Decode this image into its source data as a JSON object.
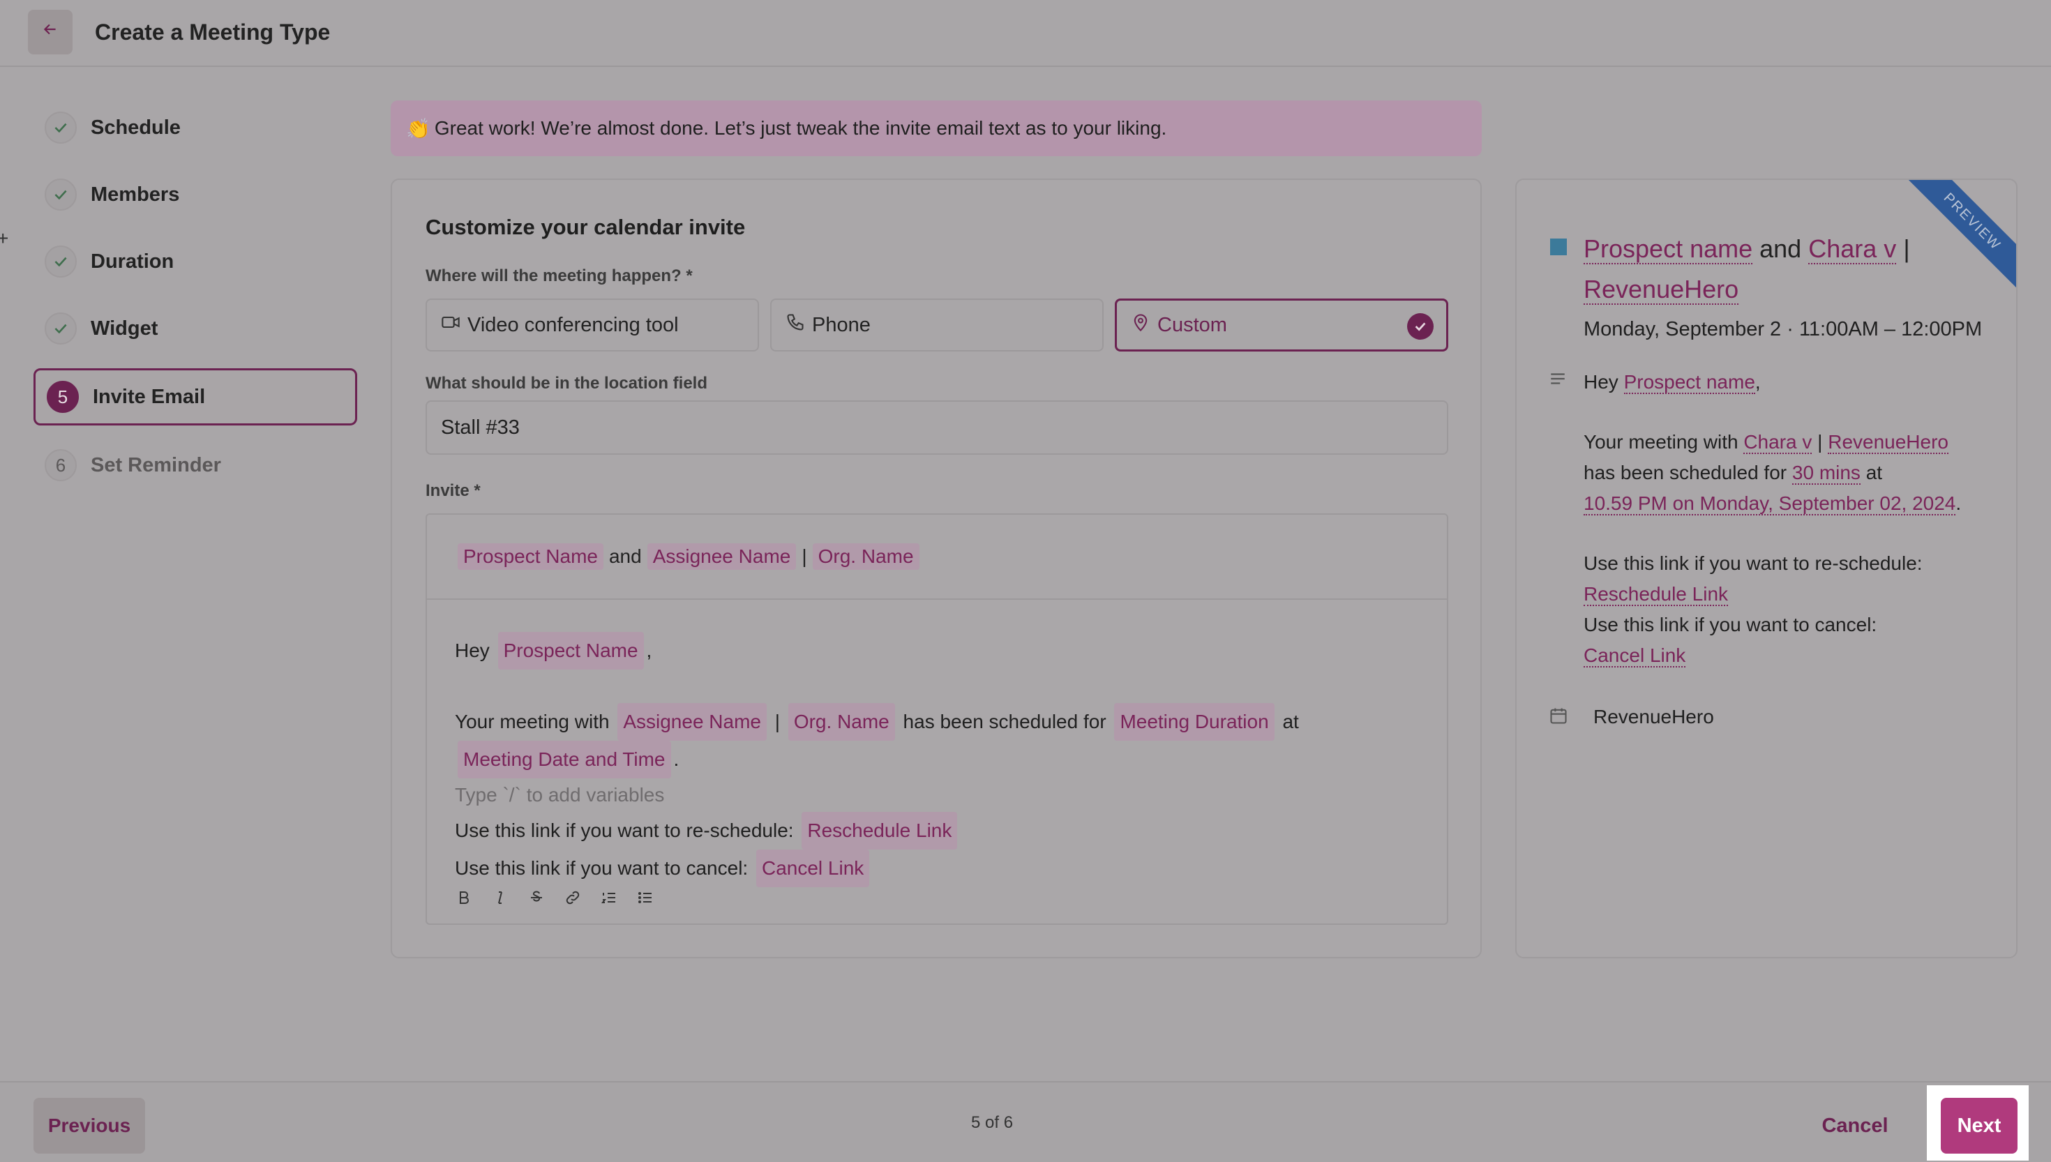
{
  "header": {
    "title": "Create a Meeting Type",
    "back_icon": "arrow-left-icon"
  },
  "stepper": {
    "steps": [
      {
        "label": "Schedule",
        "state": "done"
      },
      {
        "label": "Members",
        "state": "done"
      },
      {
        "label": "Duration",
        "state": "done"
      },
      {
        "label": "Widget",
        "state": "done"
      },
      {
        "number": "5",
        "label": "Invite Email",
        "state": "active"
      },
      {
        "number": "6",
        "label": "Set Reminder",
        "state": "pending"
      }
    ]
  },
  "banner": {
    "emoji": "👏",
    "text": "Great work! We’re almost done. Let’s just tweak the invite email text as to your liking."
  },
  "form": {
    "title": "Customize your calendar invite",
    "location_label": "Where will the meeting happen? *",
    "options": [
      {
        "label": "Video conferencing tool",
        "icon": "video-icon"
      },
      {
        "label": "Phone",
        "icon": "phone-icon"
      },
      {
        "label": "Custom",
        "icon": "map-pin-icon",
        "selected": true
      }
    ],
    "location_field_label": "What should be in the location field",
    "location_value": "Stall #33",
    "invite_label": "Invite *",
    "subject": {
      "v1": "Prospect Name",
      "and": "and",
      "v2": "Assignee Name",
      "sep": "|",
      "v3": "Org. Name"
    },
    "body": {
      "hey": "Hey",
      "prospect": "Prospect Name",
      "comma": ",",
      "line2_a": "Your meeting with",
      "assignee": "Assignee Name",
      "sep": "|",
      "org": "Org. Name",
      "line2_b": "has been scheduled for",
      "duration": "Meeting Duration",
      "at": "at",
      "datetime": "Meeting Date and Time",
      "period": ".",
      "placeholder": "Type `/` to add variables",
      "reschedule_text": "Use this link if you want to re-schedule:",
      "reschedule_link": "Reschedule Link",
      "cancel_text": "Use this link if you want to cancel:",
      "cancel_link": "Cancel Link"
    }
  },
  "preview": {
    "ribbon": "PREVIEW",
    "title": {
      "v1": "Prospect name",
      "and": "and",
      "v2": "Chara v",
      "sep": "|",
      "v3": "RevenueHero"
    },
    "date": "Monday, September 2 · 11:00AM – 12:00PM",
    "hey": "Hey",
    "prospect": "Prospect name",
    "comma": ",",
    "line_a": "Your meeting with",
    "assignee": "Chara v",
    "sep": "|",
    "org": "RevenueHero",
    "line_b": "has been scheduled for",
    "duration": "30 mins",
    "at": "at",
    "datetime": "10.59 PM on Monday, September 02, 2024",
    "period": ".",
    "reschedule_text": "Use this link if you want to re-schedule:",
    "reschedule_link": "Reschedule Link",
    "cancel_text": "Use this link if you want to cancel:",
    "cancel_link": "Cancel Link",
    "organizer": "RevenueHero"
  },
  "footer": {
    "previous": "Previous",
    "progress": "5 of 6",
    "cancel": "Cancel",
    "next": "Next"
  }
}
